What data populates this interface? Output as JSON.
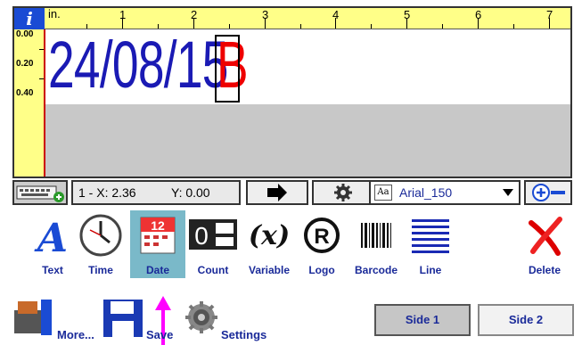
{
  "ruler": {
    "info_label": "i",
    "unit": "in.",
    "marks": [
      "1",
      "2",
      "3",
      "4",
      "5",
      "6",
      "7"
    ],
    "vmarks": [
      "0.00",
      "0.20",
      "0.40"
    ]
  },
  "canvas": {
    "date_text": "24/08/15",
    "field_char": "B"
  },
  "status": {
    "coords": "1 - X: 2.36",
    "y_coord": "Y: 0.00",
    "font_label": "Arial_150",
    "font_icon": "Aa"
  },
  "tools": [
    {
      "id": "text",
      "label": "Text"
    },
    {
      "id": "time",
      "label": "Time"
    },
    {
      "id": "date",
      "label": "Date"
    },
    {
      "id": "count",
      "label": "Count"
    },
    {
      "id": "variable",
      "label": "Variable"
    },
    {
      "id": "logo",
      "label": "Logo"
    },
    {
      "id": "barcode",
      "label": "Barcode"
    },
    {
      "id": "line",
      "label": "Line"
    },
    {
      "id": "delete",
      "label": "Delete"
    }
  ],
  "bottom": {
    "more_label": "More...",
    "save_label": "Save",
    "settings_label": "Settings",
    "side1_label": "Side 1",
    "side2_label": "Side 2"
  },
  "icons": {
    "calendar_number": "12",
    "count_digits": "0",
    "variable_symbol": "(x)",
    "logo_symbol": "R"
  }
}
